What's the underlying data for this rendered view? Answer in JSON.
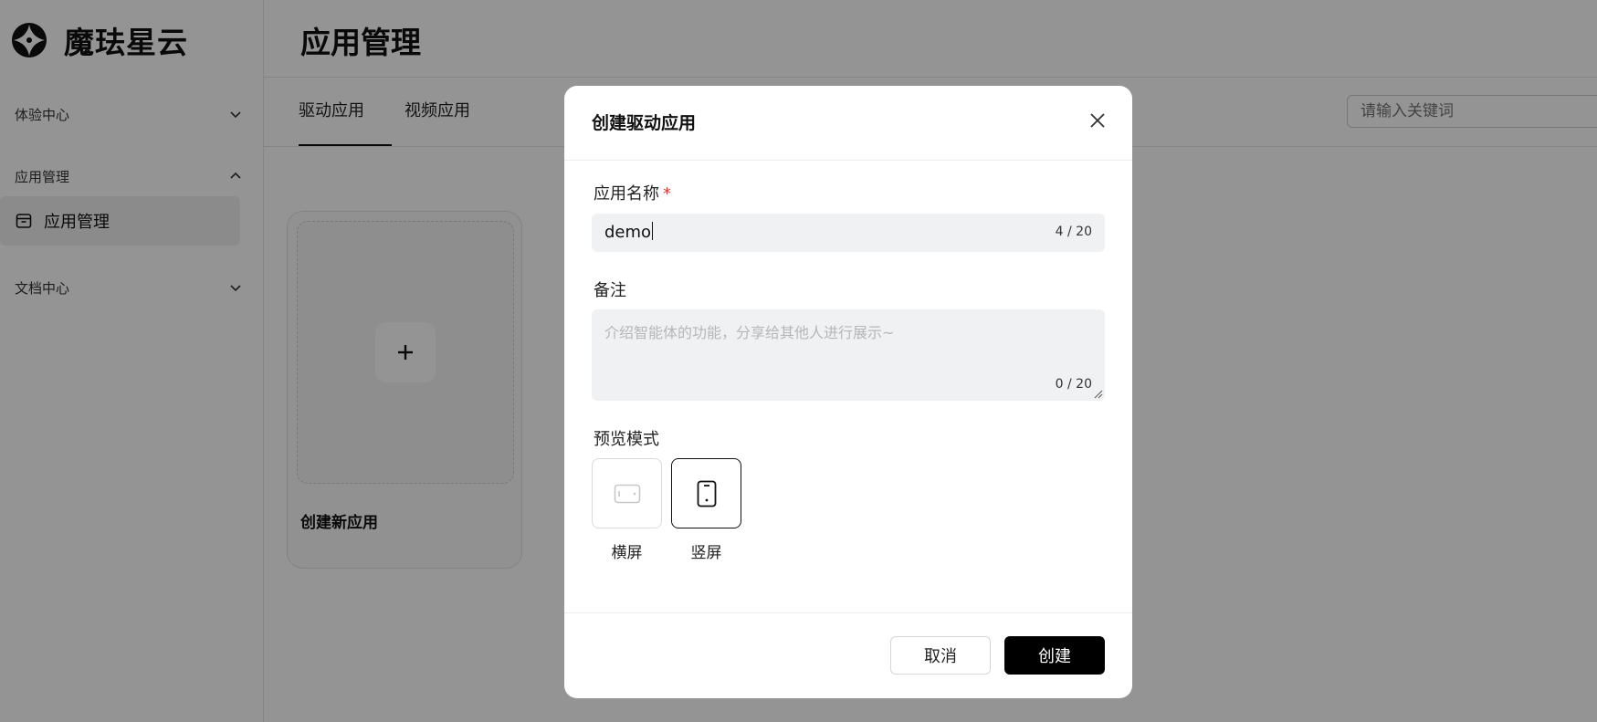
{
  "brand": {
    "name": "魔珐星云",
    "logo_icon": "brand-logo-icon"
  },
  "sidebar": {
    "groups": [
      {
        "label": "体验中心",
        "state": "collapsed"
      },
      {
        "label": "应用管理",
        "state": "expanded"
      },
      {
        "label": "文档中心",
        "state": "collapsed"
      }
    ],
    "active_item": {
      "label": "应用管理",
      "icon": "app-box-icon"
    }
  },
  "main": {
    "title": "应用管理",
    "tabs": [
      {
        "label": "驱动应用",
        "active": true
      },
      {
        "label": "视频应用",
        "active": false
      }
    ],
    "search": {
      "placeholder": "请输入关键词"
    },
    "create_card": {
      "label": "创建新应用",
      "icon": "plus-icon"
    }
  },
  "modal": {
    "title": "创建驱动应用",
    "name_field": {
      "label": "应用名称",
      "required_mark": "*",
      "value": "demo",
      "counter": "4 / 20"
    },
    "notes_field": {
      "label": "备注",
      "placeholder": "介绍智能体的功能，分享给其他人进行展示~",
      "counter": "0 / 20"
    },
    "preview_mode": {
      "label": "预览模式",
      "options": [
        {
          "label": "横屏",
          "icon": "landscape-screen-icon",
          "selected": false
        },
        {
          "label": "竖屏",
          "icon": "portrait-screen-icon",
          "selected": true
        }
      ]
    },
    "buttons": {
      "cancel": "取消",
      "create": "创建"
    }
  },
  "colors": {
    "overlay": "rgba(0,0,0,0.42)",
    "primary_button": "#000000",
    "required": "#e53935"
  }
}
